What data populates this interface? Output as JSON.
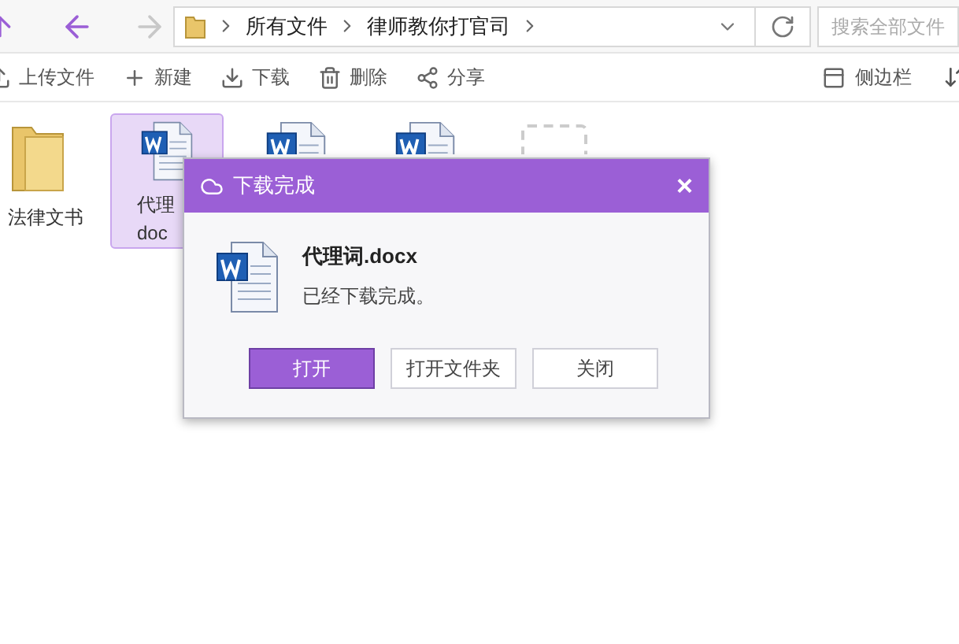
{
  "nav": {
    "breadcrumbs": [
      "所有文件",
      "律师教你打官司"
    ],
    "search": {
      "placeholder": "搜索全部文件"
    }
  },
  "toolbar": {
    "left": [
      {
        "label": "上传文件",
        "kind": "upload"
      },
      {
        "label": "新建",
        "kind": "new"
      },
      {
        "label": "下载",
        "kind": "download"
      },
      {
        "label": "删除",
        "kind": "delete"
      },
      {
        "label": "分享",
        "kind": "share"
      }
    ],
    "right": [
      {
        "label": "侧边栏",
        "kind": "sidebar"
      }
    ]
  },
  "files": [
    {
      "kind": "folder",
      "lines": [
        "法律文书"
      ],
      "selected": false
    },
    {
      "kind": "doc",
      "lines": [
        "代理",
        "doc"
      ],
      "selected": true
    },
    {
      "kind": "doc",
      "selected": false
    },
    {
      "kind": "doc",
      "selected": false
    },
    {
      "kind": "add",
      "selected": false
    }
  ],
  "dialog": {
    "title": "下载完成",
    "close": "×",
    "file_name": "代理词.docx",
    "message": "已经下载完成。",
    "buttons": [
      {
        "label": "打开",
        "primary": true
      },
      {
        "label": "打开文件夹",
        "primary": false
      },
      {
        "label": "关闭",
        "primary": false
      }
    ]
  }
}
